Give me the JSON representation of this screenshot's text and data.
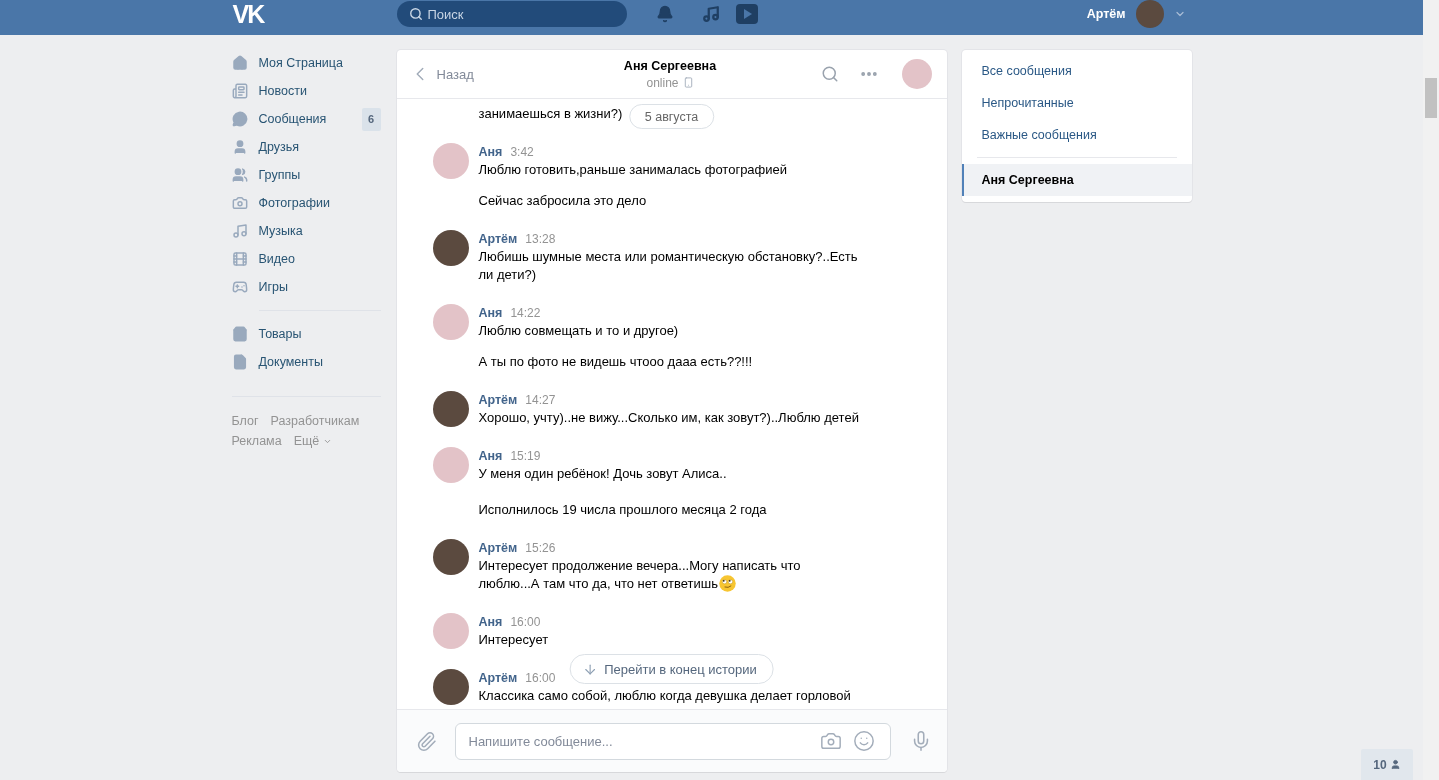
{
  "top_bar": {
    "logo": "VK",
    "search": {
      "placeholder": "Поиск"
    },
    "user_name": "Артём"
  },
  "sidebar": {
    "sections": [
      {
        "items": [
          {
            "label": "Моя Страница",
            "selected": false
          },
          {
            "label": "Новости",
            "selected": false
          },
          {
            "label": "Сообщения",
            "selected": false,
            "badge": "6"
          },
          {
            "label": "Друзья",
            "selected": false
          },
          {
            "label": "Группы",
            "selected": false
          },
          {
            "label": "Фотографии",
            "selected": false
          },
          {
            "label": "Музыка",
            "selected": false
          },
          {
            "label": "Видео",
            "selected": false
          },
          {
            "label": "Игры",
            "selected": false
          }
        ]
      },
      {
        "items": [
          {
            "label": "Товары",
            "selected": false
          },
          {
            "label": "Документы",
            "selected": false
          }
        ]
      }
    ],
    "footer_links": [
      {
        "label": "Блог",
        "dropdown": false
      },
      {
        "label": "Разработчикам",
        "dropdown": false
      },
      {
        "label": "Реклама",
        "dropdown": false
      },
      {
        "label": "Ещё",
        "dropdown": true
      }
    ]
  },
  "chat": {
    "back_label": "Назад",
    "title": "Аня Сергеевна",
    "status": "online",
    "status_mobile": true,
    "date_pill": "5 августа",
    "history": [
      {
        "kind": "continuation",
        "texts": [
          "занимаешься в жизни?)"
        ],
        "trailing_emoji": false
      },
      {
        "kind": "group",
        "author": "Аня",
        "from_me": false,
        "time": "3:42",
        "texts": [
          "Люблю готовить,раньше занималась фотографией",
          "Сейчас забросила это дело"
        ],
        "trailing_emoji": false
      },
      {
        "kind": "group",
        "author": "Артём",
        "from_me": true,
        "time": "13:28",
        "texts": [
          "Любишь шумные места или романтическую обстановку?..Есть ли дети?)"
        ],
        "trailing_emoji": false
      },
      {
        "kind": "group",
        "author": "Аня",
        "from_me": false,
        "time": "14:22",
        "texts": [
          "Люблю совмещать и то и другое)",
          "А ты по фото не видешь чтооо дааа есть??!!!"
        ],
        "trailing_emoji": false
      },
      {
        "kind": "group",
        "author": "Артём",
        "from_me": true,
        "time": "14:27",
        "texts": [
          "Хорошо, учту)..не вижу...Сколько им, как зовут?)..Люблю детей"
        ],
        "trailing_emoji": false
      },
      {
        "kind": "group",
        "author": "Аня",
        "from_me": false,
        "time": "15:19",
        "texts": [
          "У меня один ребёнок! Дочь зовут Алиса..\n\nИсполнилось 19 числа прошлого месяца 2 года"
        ],
        "trailing_emoji": false
      },
      {
        "kind": "group",
        "author": "Артём",
        "from_me": true,
        "time": "15:26",
        "texts": [
          [
            "Интересует продолжение вечера...Могу написать что",
            "люблю...А там что да, что нет ответишь"
          ]
        ],
        "trailing_emoji": true
      },
      {
        "kind": "group",
        "author": "Аня",
        "from_me": false,
        "time": "16:00",
        "texts": [
          "Интересует"
        ],
        "trailing_emoji": false
      },
      {
        "kind": "group",
        "author": "Артём",
        "from_me": true,
        "time": "16:00",
        "texts": [
          "Классика само собой, люблю когда девушка делает горловой"
        ],
        "trailing_emoji": false
      }
    ],
    "jump_button": "Перейти в конец истории",
    "composer": {
      "placeholder": "Напишите сообщение..."
    }
  },
  "filters": [
    {
      "label": "Все сообщения",
      "selected": false
    },
    {
      "label": "Непрочитанные",
      "selected": false
    },
    {
      "label": "Важные сообщения",
      "selected": false
    }
  ],
  "conversations": [
    {
      "label": "Аня Сергеевна",
      "selected": true
    }
  ],
  "online_friends": {
    "count": "10"
  }
}
